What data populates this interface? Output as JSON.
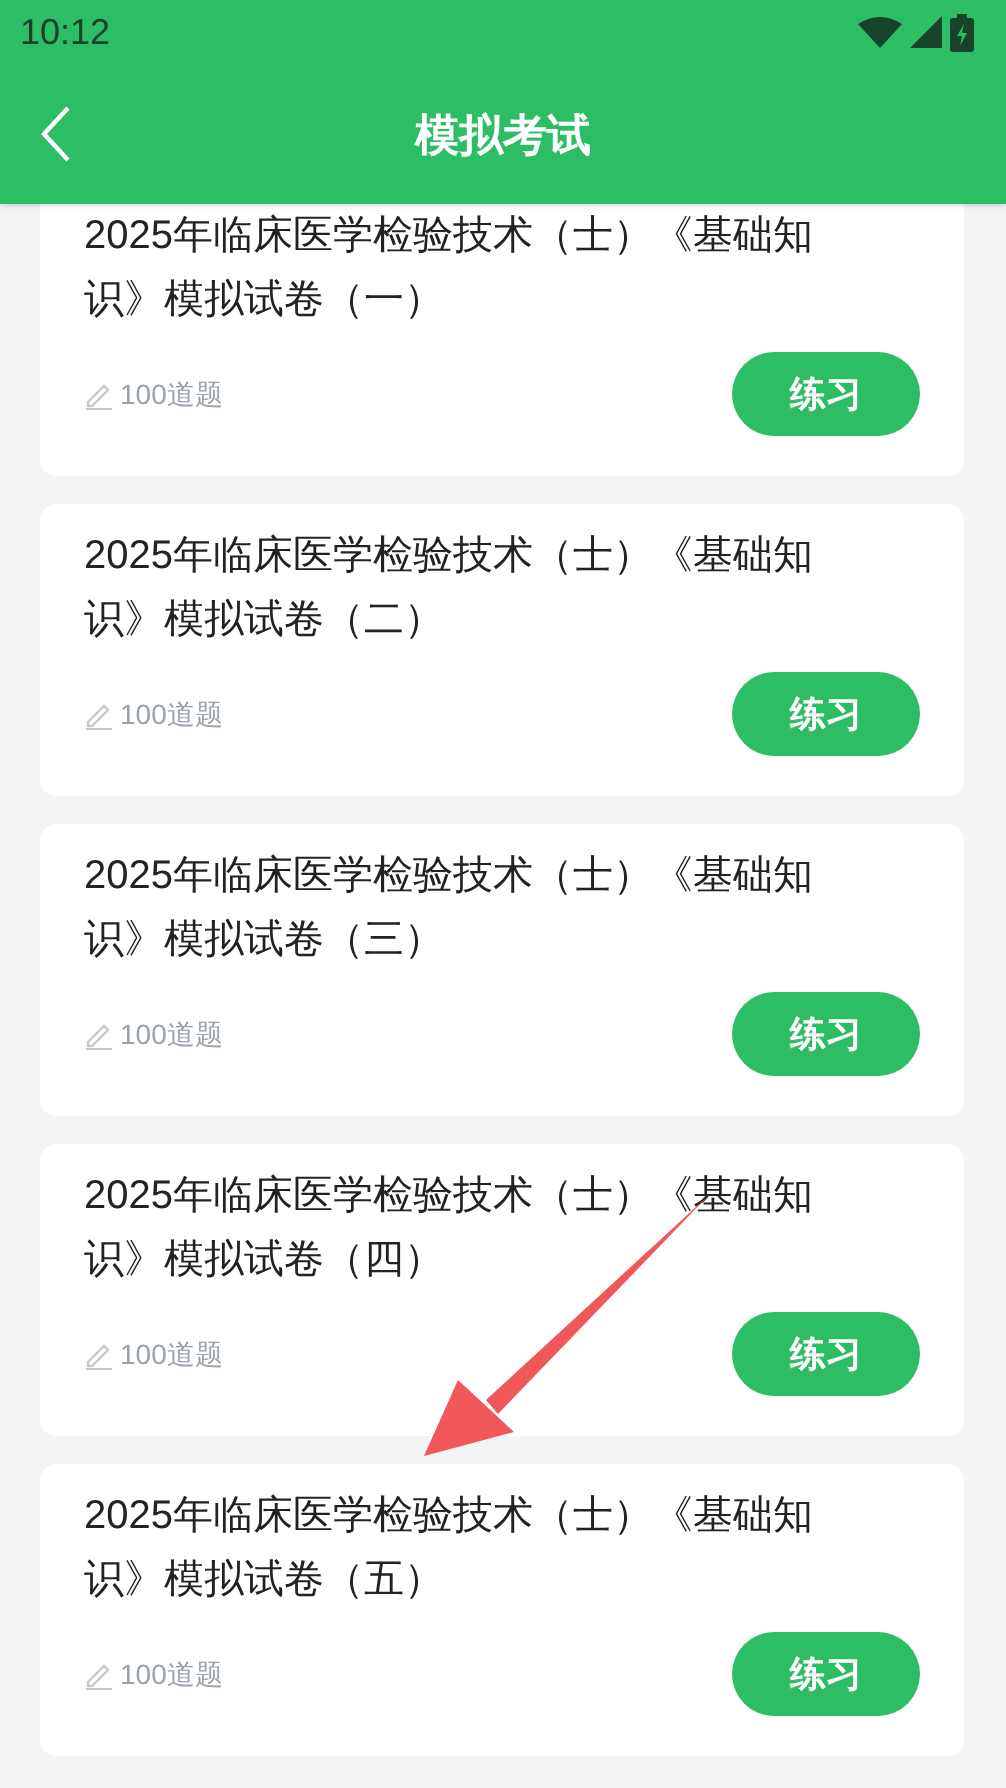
{
  "status_bar": {
    "time": "10:12"
  },
  "header": {
    "title": "模拟考试"
  },
  "exams": [
    {
      "title": "2025年临床医学检验技术（士）《基础知识》模拟试卷（一）",
      "count": "100道题",
      "button": "练习"
    },
    {
      "title": "2025年临床医学检验技术（士）《基础知识》模拟试卷（二）",
      "count": "100道题",
      "button": "练习"
    },
    {
      "title": "2025年临床医学检验技术（士）《基础知识》模拟试卷（三）",
      "count": "100道题",
      "button": "练习"
    },
    {
      "title": "2025年临床医学检验技术（士）《基础知识》模拟试卷（四）",
      "count": "100道题",
      "button": "练习"
    },
    {
      "title": "2025年临床医学检验技术（士）《基础知识》模拟试卷（五）",
      "count": "100道题",
      "button": "练习"
    }
  ]
}
